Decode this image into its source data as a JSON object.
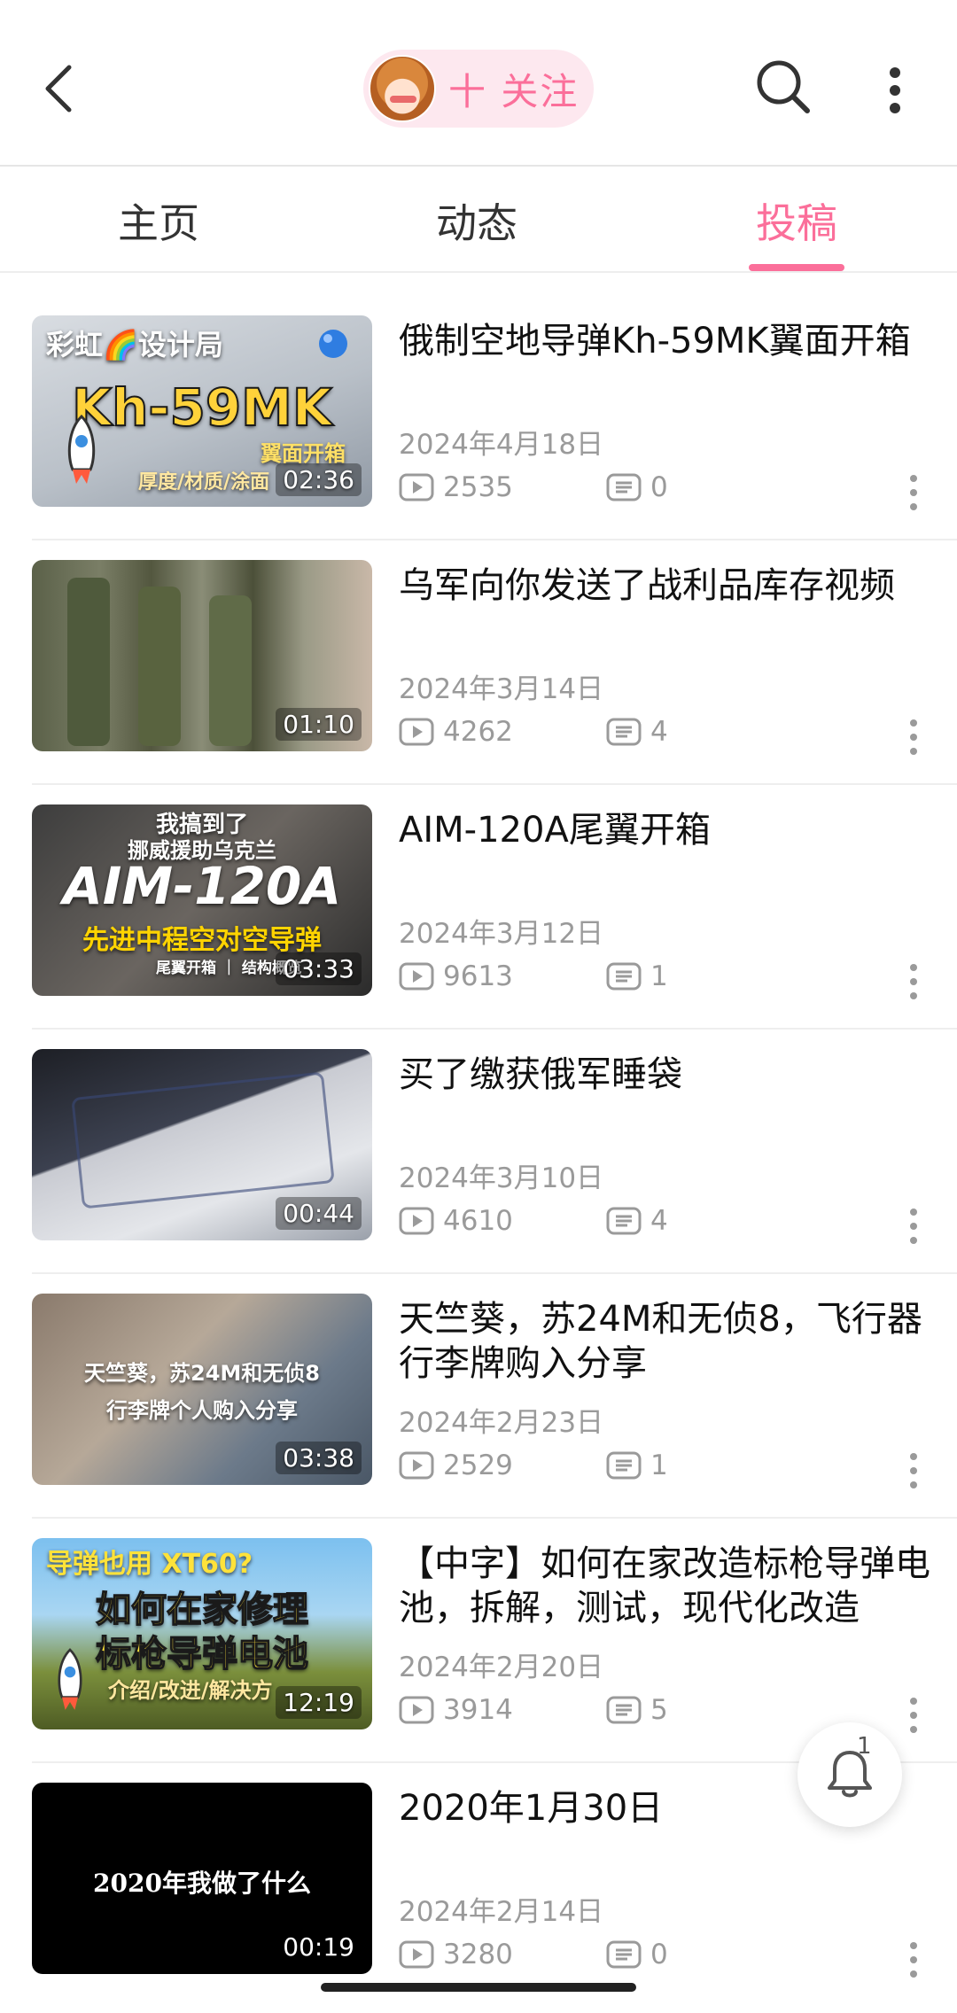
{
  "header": {
    "follow_label": "十 关注",
    "icons": [
      "back-arrow-icon",
      "search-icon",
      "more-vertical-icon"
    ]
  },
  "tabs": [
    {
      "label": "主页",
      "active": false
    },
    {
      "label": "动态",
      "active": false
    },
    {
      "label": "投稿",
      "active": true
    }
  ],
  "accent_color": "#fb6f9a",
  "videos": [
    {
      "thumb_texts": [
        "彩虹🌈设计局",
        "Kh-59MK",
        "翼面开箱",
        "厚度/材质/涂面"
      ],
      "duration": "02:36",
      "title": "俄制空地导弹Kh-59MK翼面开箱",
      "date": "2024年4月18日",
      "views": "2535",
      "comments": "0"
    },
    {
      "thumb_texts": [],
      "duration": "01:10",
      "title": "乌军向你发送了战利品库存视频",
      "date": "2024年3月14日",
      "views": "4262",
      "comments": "4"
    },
    {
      "thumb_texts": [
        "我搞到了",
        "挪威援助乌克兰",
        "AIM-120A",
        "先进中程空对空导弹",
        "尾翼开箱 ｜ 结构概览"
      ],
      "duration": "03:33",
      "title": "AIM-120A尾翼开箱",
      "date": "2024年3月12日",
      "views": "9613",
      "comments": "1"
    },
    {
      "thumb_texts": [],
      "duration": "00:44",
      "title": "买了缴获俄军睡袋",
      "date": "2024年3月10日",
      "views": "4610",
      "comments": "4"
    },
    {
      "thumb_texts": [
        "天竺葵，苏24M和无侦8",
        "行李牌个人购入分享"
      ],
      "duration": "03:38",
      "title": "天竺葵，苏24M和无侦8，飞行器行李牌购入分享",
      "date": "2024年2月23日",
      "views": "2529",
      "comments": "1"
    },
    {
      "thumb_texts": [
        "导弹也用 XT60?",
        "如何在家修理",
        "标枪导弹电池",
        "介绍/改进/解决方"
      ],
      "duration": "12:19",
      "title": "【中字】如何在家改造标枪导弹电池，拆解，测试，现代化改造",
      "date": "2024年2月20日",
      "views": "3914",
      "comments": "5"
    },
    {
      "thumb_texts": [
        "2020年我做了什么"
      ],
      "duration": "00:19",
      "title": "2020年1月30日",
      "date": "2024年2月14日",
      "views": "3280",
      "comments": "0"
    }
  ],
  "notification": {
    "count": "1",
    "icon": "bell-icon"
  }
}
